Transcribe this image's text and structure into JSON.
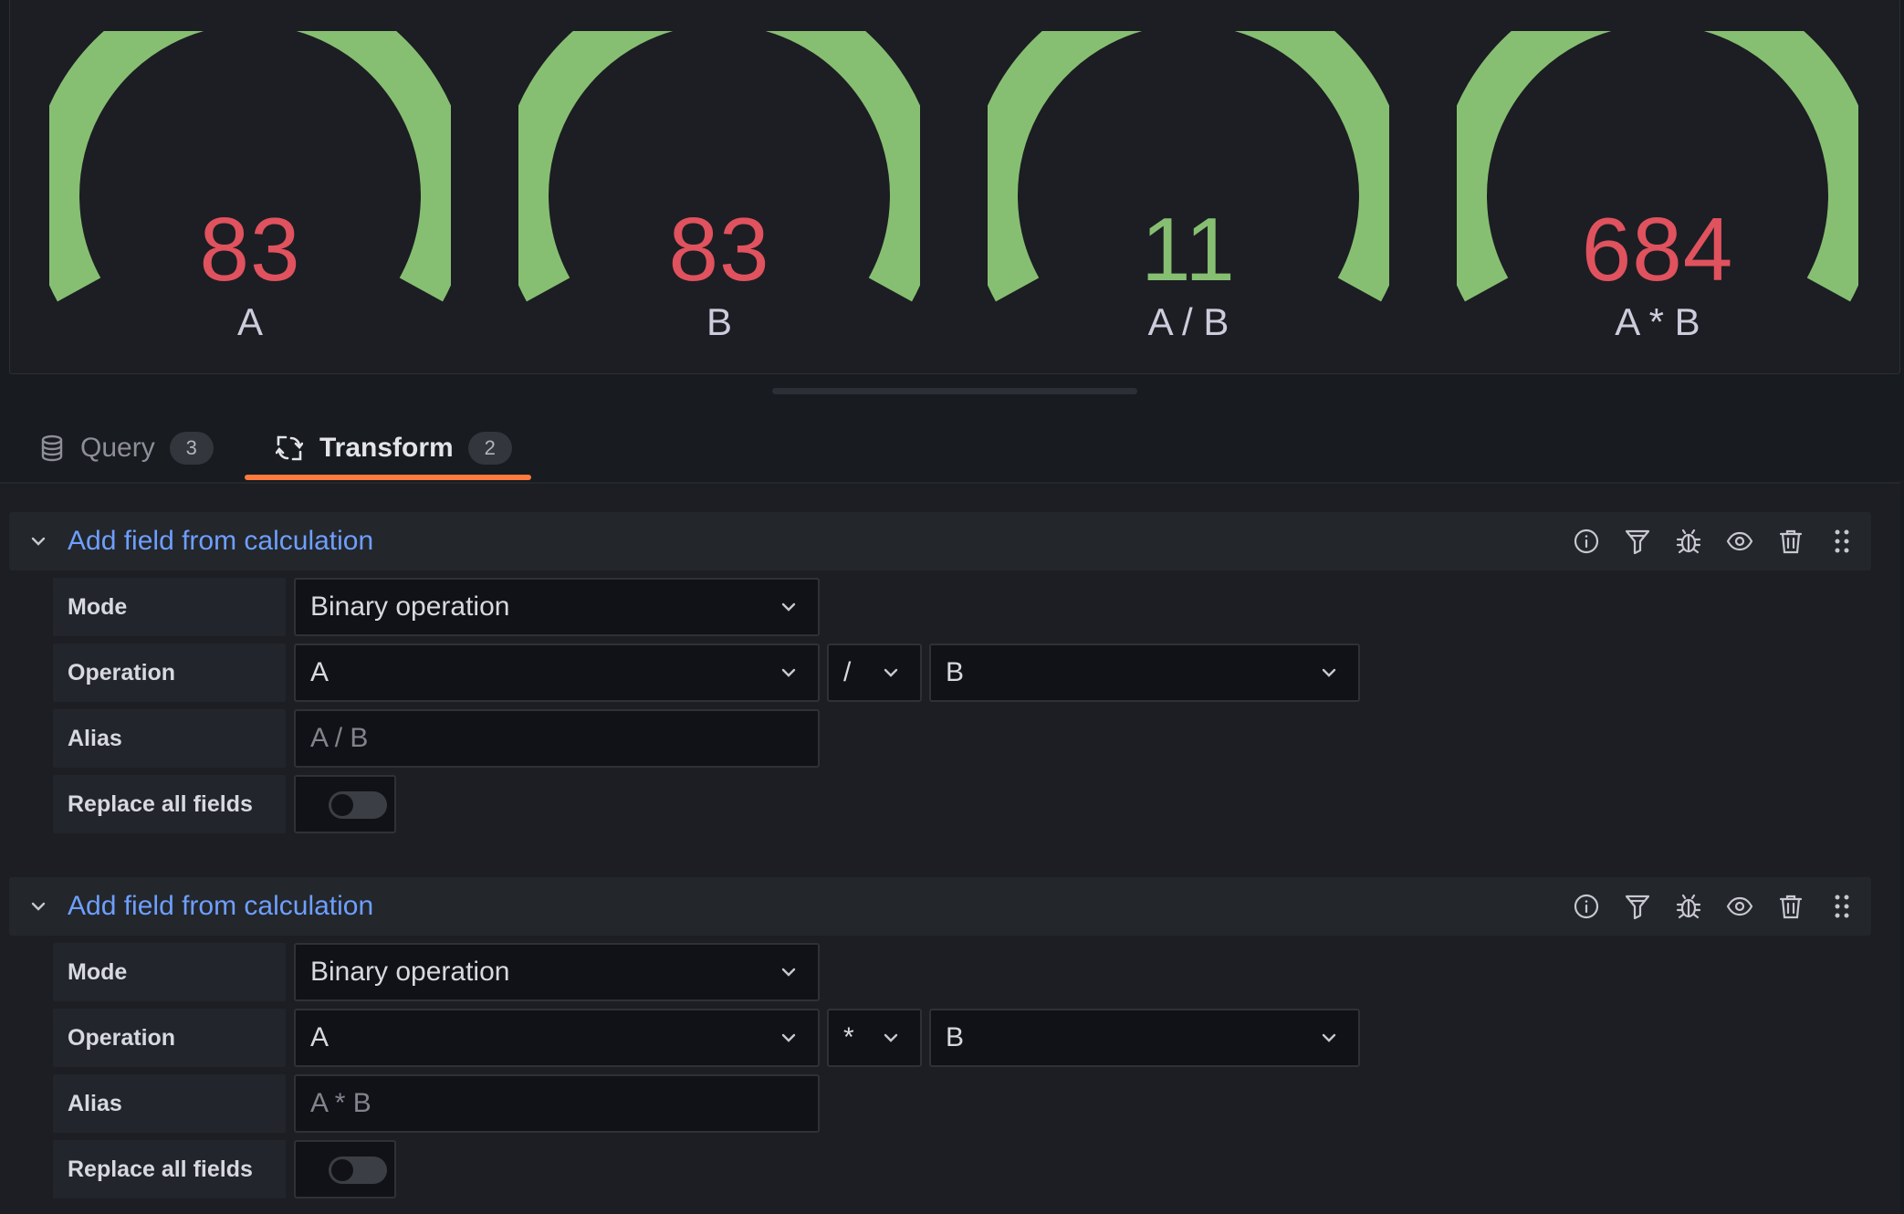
{
  "gauges": [
    {
      "value": "83",
      "label": "A",
      "color": "#e0525e",
      "gauge_color": "#87bf72"
    },
    {
      "value": "83",
      "label": "B",
      "color": "#e0525e",
      "gauge_color": "#87bf72"
    },
    {
      "value": "11",
      "label": "A / B",
      "color": "#87bf72",
      "gauge_color": "#87bf72"
    },
    {
      "value": "684",
      "label": "A * B",
      "color": "#e0525e",
      "gauge_color": "#87bf72"
    }
  ],
  "tabs": [
    {
      "label": "Query",
      "count": "3",
      "icon": "database-icon",
      "active": false
    },
    {
      "label": "Transform",
      "count": "2",
      "icon": "transform-icon",
      "active": true
    }
  ],
  "accent_color": "#ff7a3c",
  "title_color": "#6e9fff",
  "transformations": [
    {
      "title": "Add field from calculation",
      "mode_label": "Mode",
      "mode_value": "Binary operation",
      "operation_label": "Operation",
      "left_operand": "A",
      "operator": "/",
      "right_operand": "B",
      "alias_label": "Alias",
      "alias_placeholder": "A / B",
      "replace_label": "Replace all fields",
      "replace_all": false
    },
    {
      "title": "Add field from calculation",
      "mode_label": "Mode",
      "mode_value": "Binary operation",
      "operation_label": "Operation",
      "left_operand": "A",
      "operator": "*",
      "right_operand": "B",
      "alias_label": "Alias",
      "alias_placeholder": "A * B",
      "replace_label": "Replace all fields",
      "replace_all": false
    }
  ],
  "header_icons": [
    "info-icon",
    "filter-icon",
    "debug-icon",
    "eye-icon",
    "trash-icon",
    "drag-handle-icon"
  ]
}
